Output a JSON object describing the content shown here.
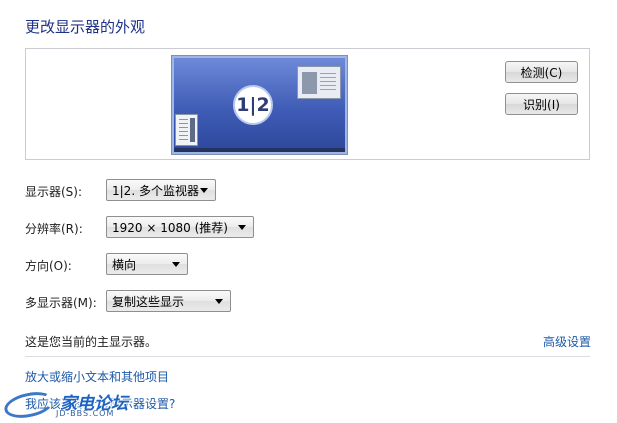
{
  "header": {
    "title": "更改显示器的外观"
  },
  "preview": {
    "monitor_label": "1|2",
    "detect_label": "检测(C)",
    "identify_label": "识别(I)"
  },
  "settings": {
    "display": {
      "label": "显示器(S):",
      "value": "1|2. 多个监视器"
    },
    "resolution": {
      "label": "分辨率(R):",
      "value": "1920 × 1080 (推荐)"
    },
    "orientation": {
      "label": "方向(O):",
      "value": "横向"
    },
    "multiple_displays": {
      "label": "多显示器(M):",
      "value": "复制这些显示"
    }
  },
  "status": {
    "main_display_text": "这是您当前的主显示器。",
    "advanced_link": "高级设置"
  },
  "links": {
    "text_size": "放大或缩小文本和其他项目",
    "which_display": "我应该选择什么显示器设置?"
  },
  "watermark": {
    "text": "家电论坛",
    "sub": "JD-BBS.COM"
  },
  "colors": {
    "title": "#1e3287",
    "link": "#1e5aa8",
    "monitor_blue": "#3f5cb6"
  }
}
